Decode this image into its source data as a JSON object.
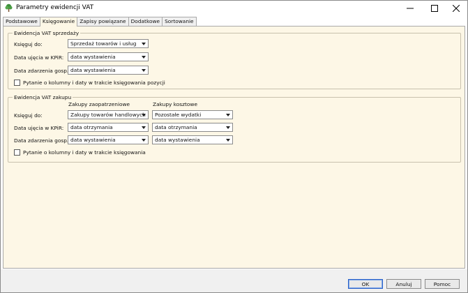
{
  "window": {
    "title": "Parametry ewidencji VAT",
    "icon": "tree-icon"
  },
  "tabs": [
    {
      "label": "Podstawowe",
      "active": false
    },
    {
      "label": "Księgowanie",
      "active": true
    },
    {
      "label": "Zapisy powiązane",
      "active": false
    },
    {
      "label": "Dodatkowe",
      "active": false
    },
    {
      "label": "Sortowanie",
      "active": false
    }
  ],
  "sales": {
    "legend": "Ewidencja VAT sprzedaży",
    "book_to_label": "Księguj do:",
    "book_to_value": "Sprzedaż towarów i usług",
    "kpir_date_label": "Data ujęcia w KPiR:",
    "kpir_date_value": "data wystawienia",
    "event_date_label": "Data zdarzenia gosp.:",
    "event_date_value": "data wystawienia",
    "ask_label": "Pytanie o kolumny i daty w trakcie księgowania pozycji",
    "ask_checked": false
  },
  "purchases": {
    "legend": "Ewidencja VAT zakupu",
    "col_supply": "Zakupy zaopatrzeniowe",
    "col_cost": "Zakupy kosztowe",
    "book_to_label": "Księguj do:",
    "book_to_supply": "Zakupy towarów handlowych",
    "book_to_cost": "Pozostałe wydatki",
    "kpir_date_label": "Data ujęcia w KPiR:",
    "kpir_date_supply": "data otrzymania",
    "kpir_date_cost": "data otrzymania",
    "event_date_label": "Data zdarzenia gosp.:",
    "event_date_supply": "data wystawienia",
    "event_date_cost": "data wystawienia",
    "ask_label": "Pytanie o kolumny i daty w trakcie księgowania",
    "ask_checked": false
  },
  "buttons": {
    "ok": "OK",
    "cancel": "Anuluj",
    "help": "Pomoc"
  },
  "colors": {
    "panel_bg": "#fdf7e6",
    "default_button_border": "#2a62c9"
  }
}
